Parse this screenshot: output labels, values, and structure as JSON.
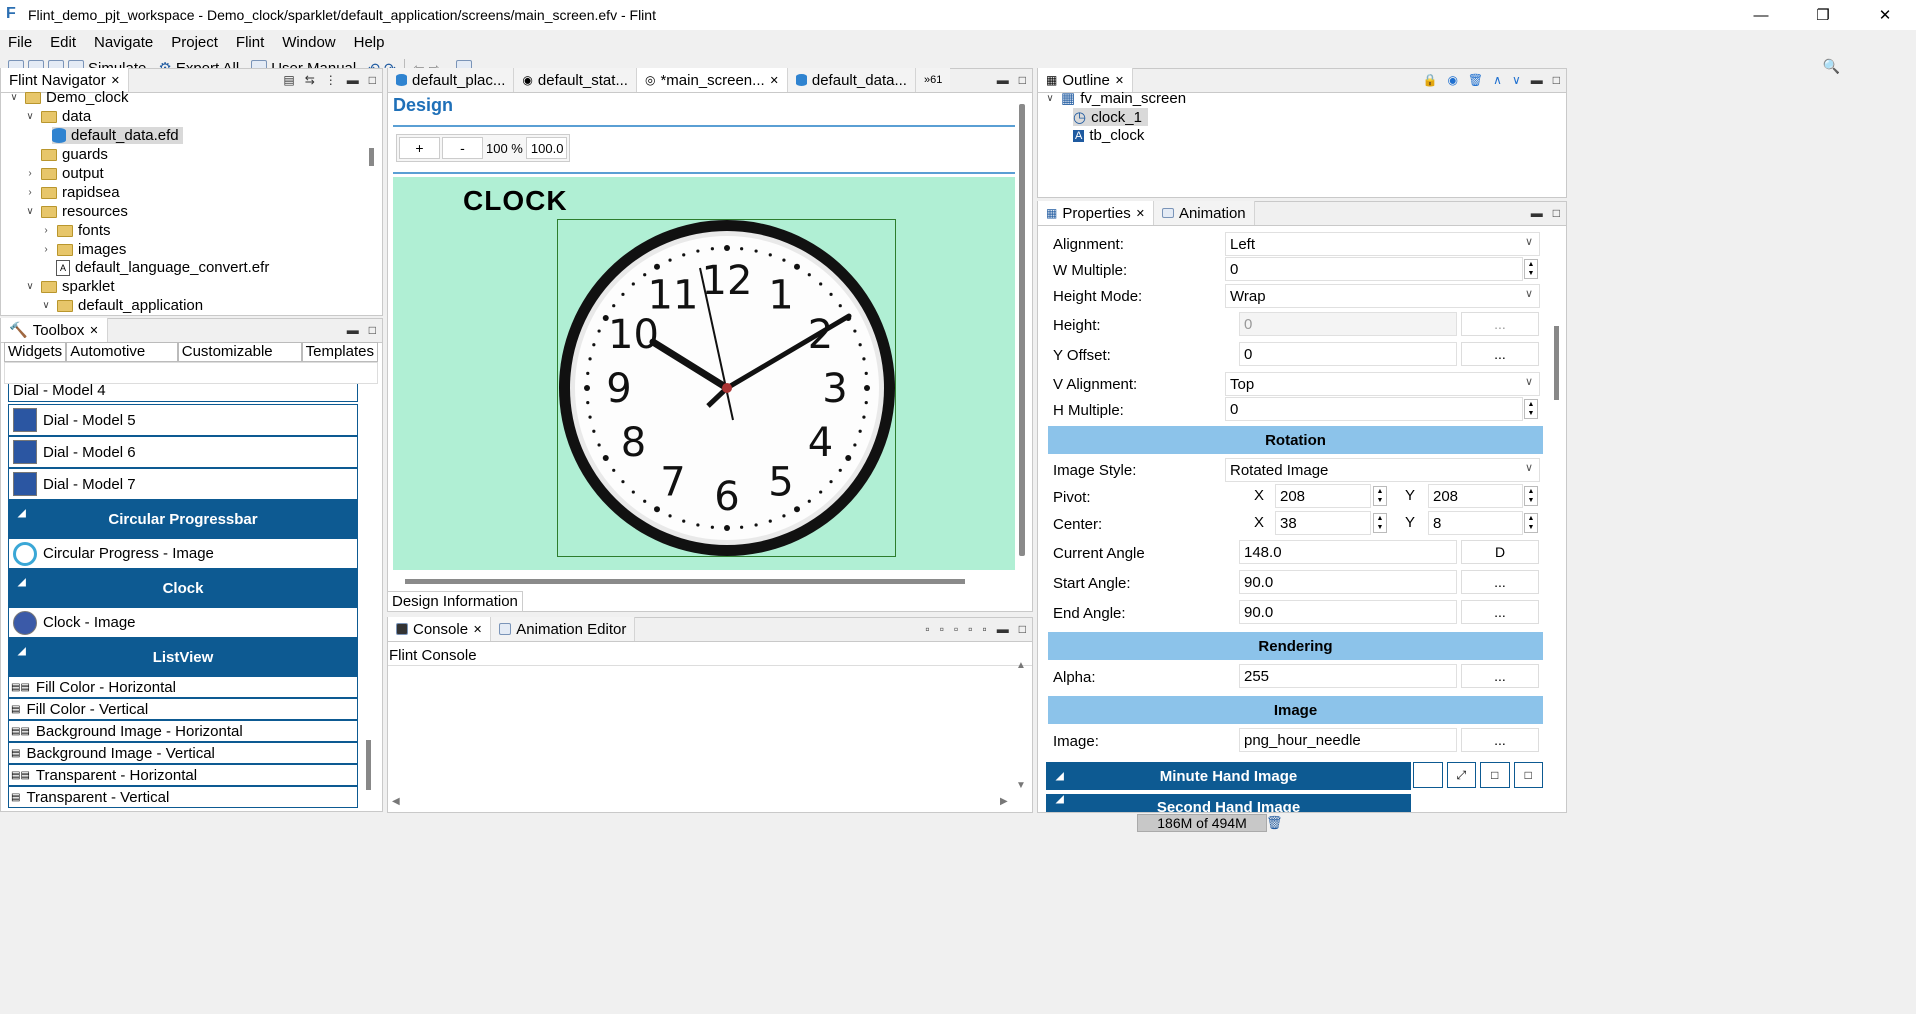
{
  "window": {
    "title": "Flint_demo_pjt_workspace - Demo_clock/sparklet/default_application/screens/main_screen.efv - Flint"
  },
  "menu": [
    "File",
    "Edit",
    "Navigate",
    "Project",
    "Flint",
    "Window",
    "Help"
  ],
  "toolbar": {
    "simulate": "Simulate",
    "export_all": "Export All",
    "user_manual": "User Manual"
  },
  "navigator": {
    "tab": "Flint Navigator",
    "items": [
      {
        "label": "Demo_clock"
      },
      {
        "label": "data"
      },
      {
        "label": "default_data.efd"
      },
      {
        "label": "guards"
      },
      {
        "label": "output"
      },
      {
        "label": "rapidsea"
      },
      {
        "label": "resources"
      },
      {
        "label": "fonts"
      },
      {
        "label": "images"
      },
      {
        "label": "default_language_convert.efr"
      },
      {
        "label": "sparklet"
      },
      {
        "label": "default_application"
      }
    ]
  },
  "toolbox": {
    "tab": "Toolbox",
    "tabs": [
      "Widgets",
      "Automotive Widgets",
      "Customizable Widgets",
      "Templates"
    ],
    "items": {
      "dial4": "Dial - Model 4",
      "dial5": "Dial - Model 5",
      "dial6": "Dial - Model 6",
      "dial7": "Dial - Model 7",
      "hdr_circ": "Circular Progressbar",
      "circ_img": "Circular Progress - Image",
      "hdr_clock": "Clock",
      "clock_img": "Clock - Image",
      "hdr_list": "ListView",
      "fill_h": "Fill Color - Horizontal",
      "fill_v": "Fill Color - Vertical",
      "bg_h": "Background Image - Horizontal",
      "bg_v": "Background Image - Vertical",
      "tr_h": "Transparent - Horizontal",
      "tr_v": "Transparent - Vertical"
    }
  },
  "editor": {
    "tabs": [
      "default_plac...",
      "default_stat...",
      "*main_screen...",
      "default_data..."
    ],
    "overflow": "»61",
    "design_title": "Design",
    "zoom_plus": "+",
    "zoom_minus": "-",
    "zoom_pct": "100 %",
    "zoom_value": "100.0",
    "canvas_heading": "CLOCK",
    "bottom_tab": "Design Information",
    "canvas_color": "#b0efd4",
    "clock_numbers": [
      "12",
      "1",
      "2",
      "3",
      "4",
      "5",
      "6",
      "7",
      "8",
      "9",
      "10",
      "11"
    ]
  },
  "console": {
    "tab": "Console",
    "tab2": "Animation Editor",
    "title": "Flint Console"
  },
  "outline": {
    "tab": "Outline",
    "root": "fv_main_screen",
    "children": [
      "clock_1",
      "tb_clock"
    ]
  },
  "properties": {
    "tab": "Properties",
    "tab2": "Animation",
    "alignment_label": "Alignment:",
    "alignment": "Left",
    "wmult_label": "W Multiple:",
    "wmult": "0",
    "heightmode_label": "Height Mode:",
    "heightmode": "Wrap",
    "height_label": "Height:",
    "height": "0",
    "yoffset_label": "Y Offset:",
    "yoffset": "0",
    "valign_label": "V Alignment:",
    "valign": "Top",
    "hmult_label": "H Multiple:",
    "hmult": "0",
    "rotation": "Rotation",
    "imgstyle_label": "Image Style:",
    "imgstyle": "Rotated Image",
    "pivot_label": "Pivot:",
    "pivot_x": "208",
    "pivot_y": "208",
    "center_label": "Center:",
    "center_x": "38",
    "center_y": "8",
    "x": "X",
    "y": "Y",
    "curangle_label": "Current Angle",
    "curangle": "148.0",
    "d_btn": "D",
    "startangle_label": "Start Angle:",
    "startangle": "90.0",
    "endangle_label": "End Angle:",
    "endangle": "90.0",
    "rendering": "Rendering",
    "alpha_label": "Alpha:",
    "alpha": "255",
    "image_section": "Image",
    "image_label": "Image:",
    "image": "png_hour_needle",
    "dots": "...",
    "minute_hand": "Minute Hand Image",
    "second_hand": "Second Hand Image"
  },
  "status": {
    "memory": "186M of 494M"
  },
  "colors": {
    "accent": "#0d5a92",
    "section": "#8cc3ea",
    "design_title": "#1f70b8"
  }
}
